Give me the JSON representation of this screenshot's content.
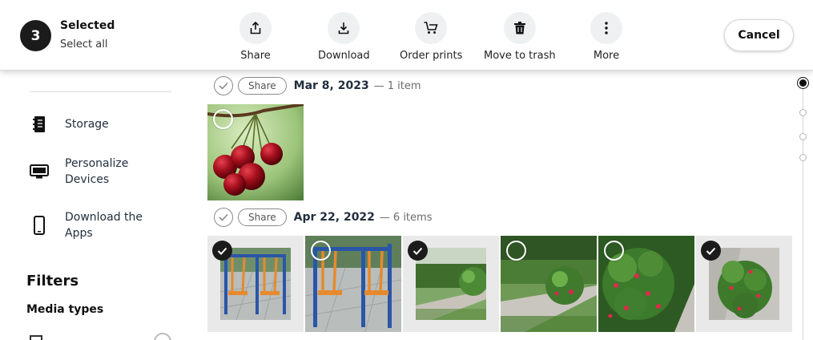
{
  "selection_bar": {
    "count": "3",
    "title": "Selected",
    "select_all": "Select all",
    "actions": [
      {
        "label": "Share",
        "icon": "share-icon"
      },
      {
        "label": "Download",
        "icon": "download-icon"
      },
      {
        "label": "Order prints",
        "icon": "cart-icon"
      },
      {
        "label": "Move to trash",
        "icon": "trash-icon"
      },
      {
        "label": "More",
        "icon": "more-vertical-icon"
      }
    ],
    "cancel": "Cancel"
  },
  "sidebar": {
    "items": [
      {
        "label": "Storage",
        "icon": "storage-icon"
      },
      {
        "label": "Personalize Devices",
        "icon": "monitor-icon"
      },
      {
        "label": "Download the Apps",
        "icon": "phone-icon"
      }
    ],
    "filters_heading": "Filters",
    "media_types_heading": "Media types"
  },
  "groups": [
    {
      "date": "Mar 8, 2023",
      "separator": "—",
      "count": "1 item",
      "share": "Share"
    },
    {
      "date": "Apr 22, 2022",
      "separator": "—",
      "count": "6 items",
      "share": "Share"
    }
  ],
  "photos": {
    "group1": [
      {
        "subject": "cherries",
        "selected": false
      }
    ],
    "group2": [
      {
        "subject": "outdoor exercise equipment",
        "selected": true
      },
      {
        "subject": "outdoor exercise equipment",
        "selected": false
      },
      {
        "subject": "garden path with shrubs",
        "selected": true
      },
      {
        "subject": "garden path with shrubs",
        "selected": false
      },
      {
        "subject": "flowering shrub",
        "selected": false
      },
      {
        "subject": "flowering shrub",
        "selected": true
      }
    ]
  },
  "timeline": {
    "markers": 4,
    "active_index": 0
  },
  "colors": {
    "dark": "#1b1b1b",
    "text": "#232f3e",
    "muted": "#6b6b6b",
    "action_bg": "#eef0f2"
  }
}
